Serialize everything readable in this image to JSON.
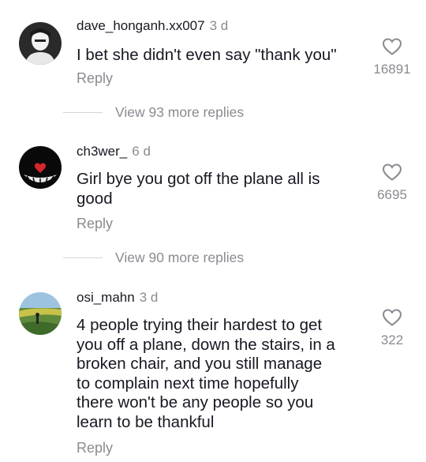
{
  "comments": [
    {
      "username": "dave_honganh.xx007",
      "time": "3 d",
      "text_lines": [
        "I bet she didn't even say \"thank you\""
      ],
      "reply_label": "Reply",
      "likes": "16891",
      "more_replies": "View 93 more replies"
    },
    {
      "username": "ch3wer_",
      "time": "6 d",
      "text_lines": [
        "Girl bye you got off the plane all is",
        "good"
      ],
      "reply_label": "Reply",
      "likes": "6695",
      "more_replies": "View 90 more replies"
    },
    {
      "username": "osi_mahn",
      "time": "3 d",
      "text_lines": [
        "4 people trying their hardest to get",
        "you off a plane, down the stairs, in a",
        "broken chair, and you still manage",
        "to complain next time hopefully",
        "there won't be any people so you",
        "learn to be thankful"
      ],
      "reply_label": "Reply",
      "likes": "322"
    }
  ],
  "icons": {
    "like": "heart-outline-icon",
    "avatar": "avatar-image"
  },
  "colors": {
    "text": "#161823",
    "secondary": "#8a8b91"
  }
}
